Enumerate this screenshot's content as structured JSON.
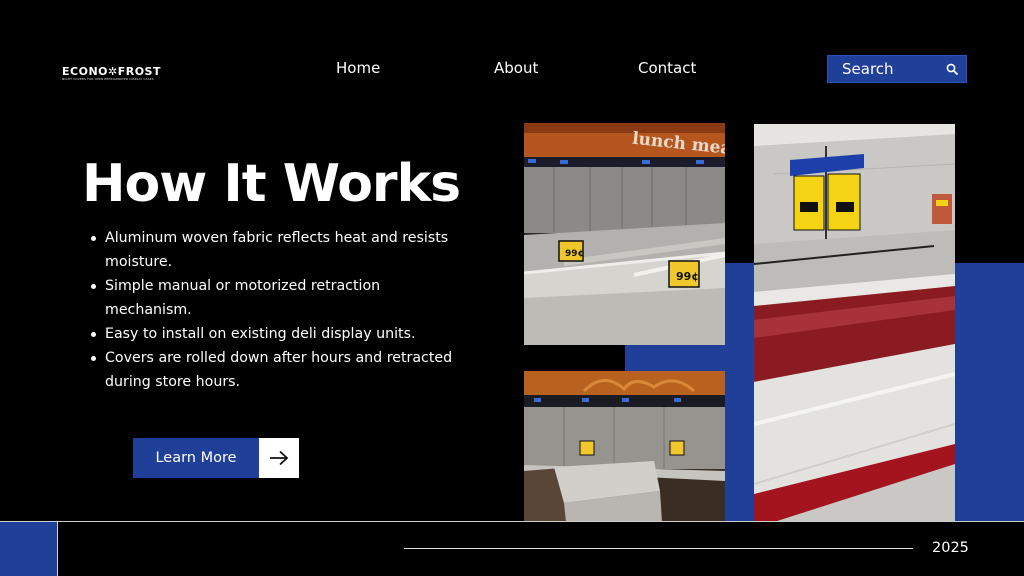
{
  "brand": {
    "name": "ECONO✲FROST",
    "tagline": "NIGHT COVERS FOR OPEN REFRIGERATED DISPLAY CASES"
  },
  "nav": {
    "home": "Home",
    "about": "About",
    "contact": "Contact",
    "search_label": "Search"
  },
  "main": {
    "title": "How It Works",
    "bullets": [
      "Aluminum woven fabric reflects heat and resists moisture.",
      "Simple manual or motorized retraction mechanism.",
      "Easy to install on existing deli display units.",
      "Covers are rolled down after hours and retracted during store hours."
    ],
    "cta_label": "Learn More"
  },
  "photos": {
    "sign_lunch_meat": "lunch meat",
    "price_tag": "99¢"
  },
  "footer": {
    "year": "2025"
  },
  "colors": {
    "background": "#000000",
    "accent_blue": "#1f3f99",
    "text": "#ffffff"
  },
  "icons": {
    "search": "magnifier-icon",
    "cta": "arrow-right-icon"
  }
}
